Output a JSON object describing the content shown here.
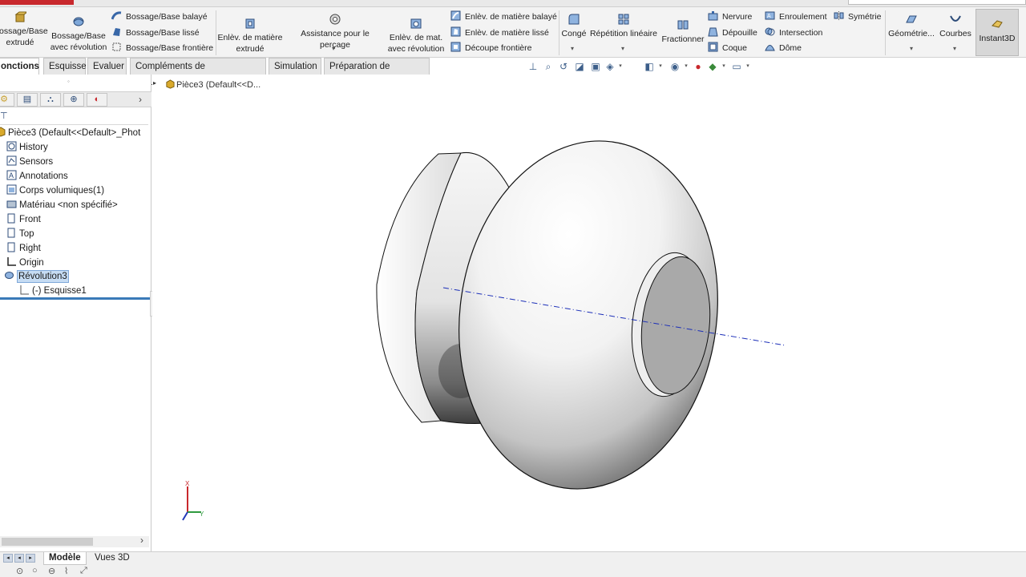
{
  "ribbon": {
    "extruded_boss": "Bossage/Base extrudé",
    "revolved_boss": "Bossage/Base avec révolution",
    "swept_boss": "Bossage/Base balayé",
    "lofted_boss": "Bossage/Base lissé",
    "boundary_boss": "Bossage/Base frontière",
    "extruded_cut": "Enlèv. de matière extrudé",
    "hole_wizard": "Assistance pour le perçage",
    "revolved_cut": "Enlèv. de mat. avec révolution",
    "swept_cut": "Enlèv. de matière balayé",
    "lofted_cut": "Enlèv. de matière lissé",
    "boundary_cut": "Découpe frontière",
    "fillet": "Congé",
    "linear_pattern": "Répétition linéaire",
    "split": "Fractionner",
    "rib": "Nervure",
    "draft": "Dépouille",
    "shell": "Coque",
    "wrap": "Enroulement",
    "intersect": "Intersection",
    "dome": "Dôme",
    "mirror": "Symétrie",
    "ref_geometry": "Géométrie...",
    "curves": "Courbes",
    "instant3d": "Instant3D"
  },
  "tabs": [
    {
      "label": "onctions"
    },
    {
      "label": "Esquisse"
    },
    {
      "label": "Evaluer"
    },
    {
      "label": "Compléments de SOLIDWORKS"
    },
    {
      "label": "Simulation"
    },
    {
      "label": "Préparation de l'analyse"
    }
  ],
  "tree": {
    "root": "Pièce3  (Default<<Default>_Phot",
    "items": [
      {
        "label": "History",
        "icon": "history-icon"
      },
      {
        "label": "Sensors",
        "icon": "sensors-icon"
      },
      {
        "label": "Annotations",
        "icon": "annotations-icon"
      },
      {
        "label": "Corps volumiques(1)",
        "icon": "solid-bodies-icon"
      },
      {
        "label": "Matériau <non spécifié>",
        "icon": "material-icon"
      },
      {
        "label": "Front",
        "icon": "plane-icon"
      },
      {
        "label": "Top",
        "icon": "plane-icon"
      },
      {
        "label": "Right",
        "icon": "plane-icon"
      },
      {
        "label": "Origin",
        "icon": "origin-icon"
      },
      {
        "label": "Révolution3",
        "icon": "revolve-feature-icon",
        "selected": true
      },
      {
        "label": "(-) Esquisse1",
        "icon": "sketch-icon"
      }
    ]
  },
  "viewport": {
    "breadcrumb": "Pièce3  (Default<<D..."
  },
  "triad": {
    "x": "X",
    "y": "Y"
  },
  "bottom_tabs": [
    {
      "label": "Modèle",
      "active": true
    },
    {
      "label": "Vues 3D",
      "active": false
    }
  ],
  "colors": {
    "accent": "#3a7ab8",
    "selection": "#c6dcf3",
    "axis": "#1c2fb8"
  }
}
